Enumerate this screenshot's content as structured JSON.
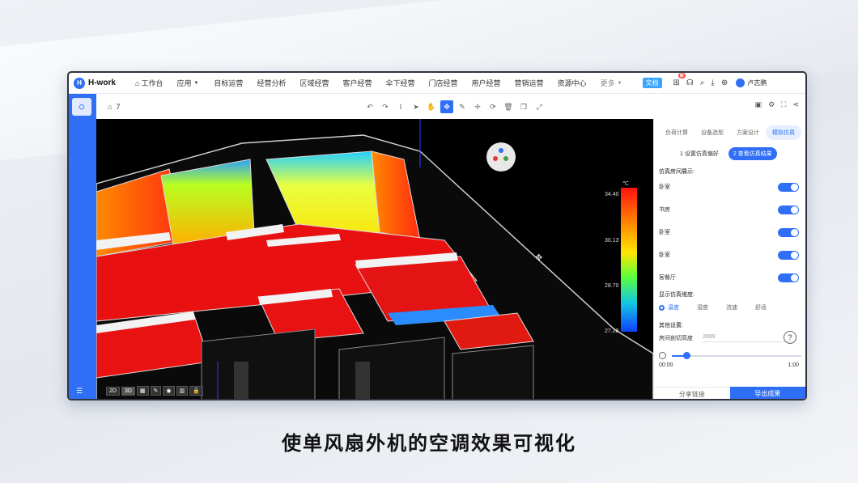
{
  "app": {
    "logo": "H-work"
  },
  "nav": {
    "items": [
      {
        "label": "工作台",
        "icon": "home-icon"
      },
      {
        "label": "应用",
        "icon": "chevron-down-icon"
      },
      {
        "label": "目标运营"
      },
      {
        "label": "经营分析"
      },
      {
        "label": "区域经营"
      },
      {
        "label": "客户经营"
      },
      {
        "label": "伞下经营"
      },
      {
        "label": "门店经营"
      },
      {
        "label": "用户经营"
      },
      {
        "label": "营销运营"
      },
      {
        "label": "资源中心"
      }
    ],
    "more": "更多",
    "doc": "文档",
    "badge": "新",
    "user": "卢志鹏"
  },
  "toolbar": {
    "floor": "7"
  },
  "viewport": {
    "legend": {
      "unit": "℃",
      "labels": [
        "34.40",
        "30.13",
        "28.70",
        "27.28"
      ]
    },
    "view_modes": [
      "2D",
      "3D"
    ]
  },
  "panel": {
    "tabs": [
      "负荷计算",
      "设备选型",
      "方案设计",
      "模拟仿真"
    ],
    "active_tab": 3,
    "steps": [
      "1 设置仿真偏好",
      "2 查看仿真结果"
    ],
    "rooms_title": "仿真房间展示:",
    "rooms": [
      "卧室",
      "书房",
      "卧室",
      "卧室",
      "客餐厅"
    ],
    "dimension_title": "显示仿真维度:",
    "dimensions": [
      "温度",
      "湿度",
      "流速",
      "舒适"
    ],
    "other_title": "其他设置:",
    "height_label": "房间剖切高度",
    "height_value": "2899",
    "time_start": "00:00",
    "time_end": "1:00",
    "share": "分享链接",
    "export": "导出成果"
  },
  "subtitle": "使单风扇外机的空调效果可视化",
  "colors": {
    "accent": "#2f6ff5"
  }
}
